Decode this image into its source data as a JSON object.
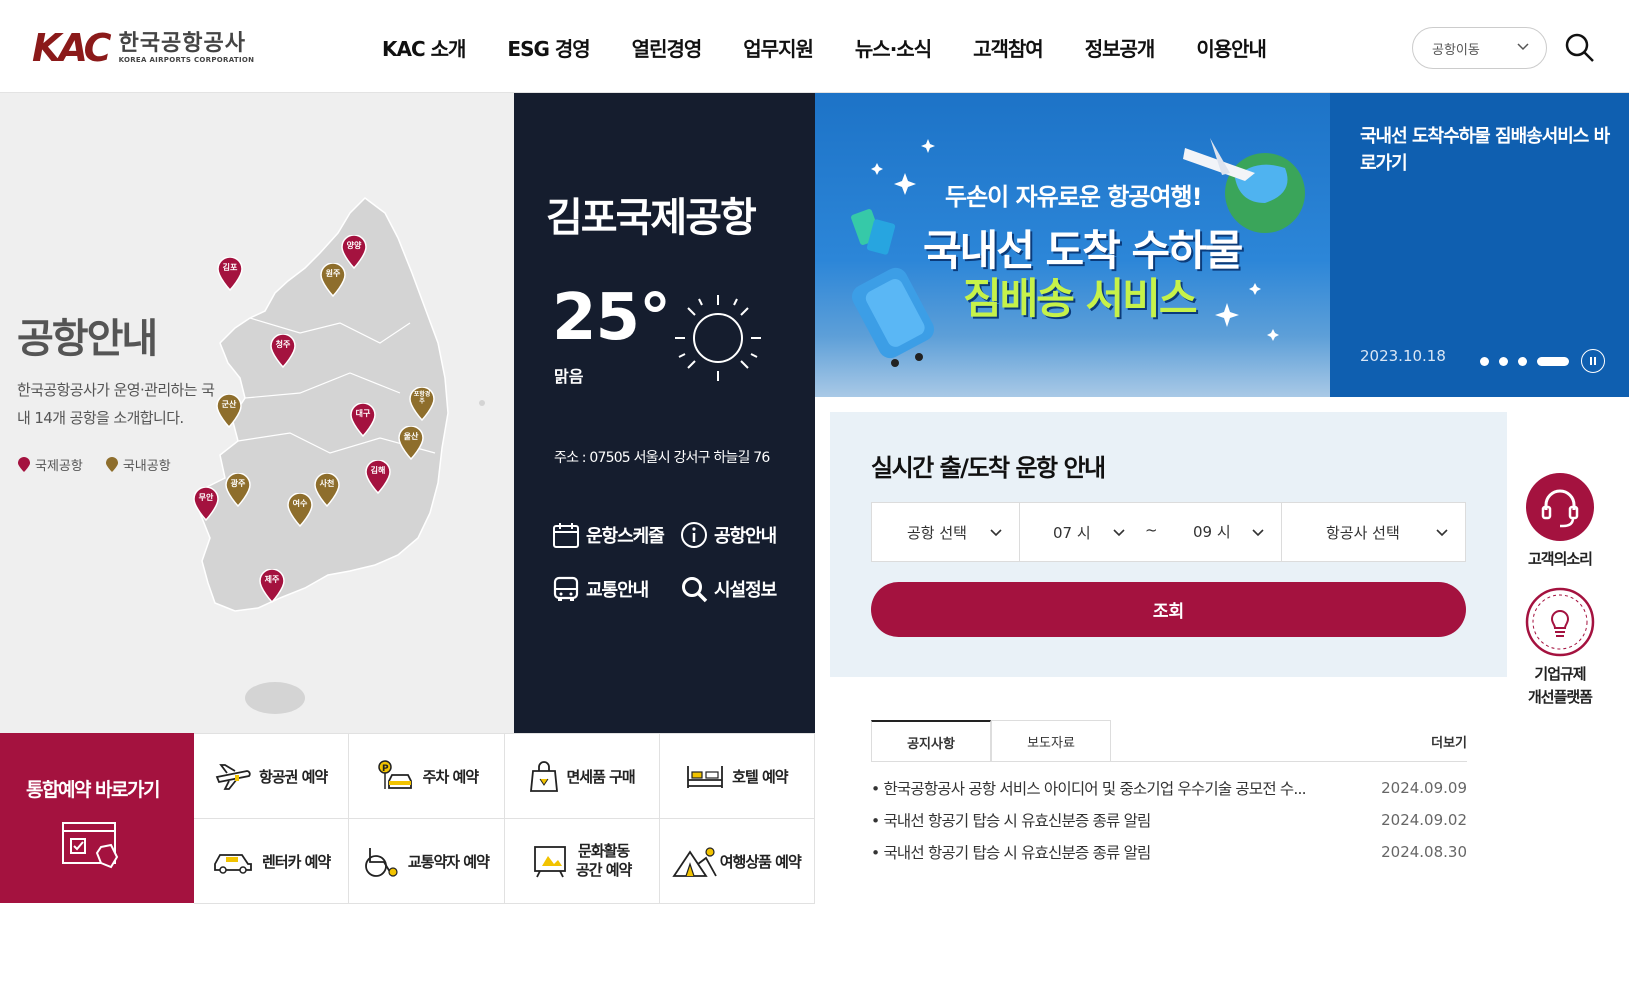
{
  "header": {
    "logo_mark": "KAC",
    "logo_ko": "한국공항공사",
    "logo_en": "KOREA AIRPORTS CORPORATION",
    "nav": [
      "KAC 소개",
      "ESG 경영",
      "열린경영",
      "업무지원",
      "뉴스·소식",
      "고객참여",
      "정보공개",
      "이용안내"
    ],
    "airport_select": "공항이동"
  },
  "map": {
    "title": "공항안내",
    "desc": "한국공항공사가 운영·관리하는 국내 14개 공항을 소개합니다.",
    "legend_intl": "국제공항",
    "legend_domestic": "국내공항",
    "airports": [
      {
        "name": "김포",
        "type": "intl"
      },
      {
        "name": "양양",
        "type": "intl"
      },
      {
        "name": "원주",
        "type": "domestic"
      },
      {
        "name": "청주",
        "type": "intl"
      },
      {
        "name": "군산",
        "type": "domestic"
      },
      {
        "name": "대구",
        "type": "intl"
      },
      {
        "name": "포항경주",
        "type": "domestic"
      },
      {
        "name": "울산",
        "type": "domestic"
      },
      {
        "name": "김해",
        "type": "intl"
      },
      {
        "name": "광주",
        "type": "domestic"
      },
      {
        "name": "무안",
        "type": "intl"
      },
      {
        "name": "사천",
        "type": "domestic"
      },
      {
        "name": "여수",
        "type": "domestic"
      },
      {
        "name": "제주",
        "type": "intl"
      }
    ],
    "intl_color": "#a4123f",
    "domestic_color": "#8e6e2c"
  },
  "weather": {
    "airport": "김포국제공항",
    "temp": "25°",
    "condition": "맑음",
    "address": "주소 : 07505 서울시 강서구 하늘길 76",
    "links": [
      "운항스케줄",
      "공항안내",
      "교통안내",
      "시설정보"
    ]
  },
  "banner": {
    "sub": "두손이 자유로운 항공여행!",
    "main1": "국내선 도착 수하물",
    "main2": "짐배송 서비스",
    "title": "국내선 도착수하물 짐배송서비스 바로가기",
    "date": "2023.10.18"
  },
  "flight": {
    "title": "실시간 출/도착 운항 안내",
    "airport": "공항 선택",
    "from_hour": "07 시",
    "tilde": "~",
    "to_hour": "09 시",
    "airline": "항공사 선택",
    "search": "조회"
  },
  "notice": {
    "tabs": [
      "공지사항",
      "보도자료"
    ],
    "more": "더보기",
    "items": [
      {
        "title": "한국공항공사 공항 서비스 아이디어 및 중소기업 우수기술 공모전 수...",
        "date": "2024.09.09"
      },
      {
        "title": "국내선 항공기 탑승 시 유효신분증 종류 알림",
        "date": "2024.09.02"
      },
      {
        "title": "국내선 항공기 탑승 시 유효신분증 종류 알림",
        "date": "2024.08.30"
      }
    ]
  },
  "quick": {
    "voice": "고객의소리",
    "regulation_1": "기업규제",
    "regulation_2": "개선플랫폼"
  },
  "reserve": {
    "main": "통합예약 바로가기",
    "items": [
      "항공권 예약",
      "주차 예약",
      "면세품 구매",
      "호텔 예약",
      "렌터카 예약",
      "교통약자 예약",
      "문화활동 공간 예약",
      "여행상품 예약"
    ],
    "culture_1": "문화활동",
    "culture_2": "공간 예약"
  },
  "colors": {
    "brand": "#a4123f",
    "dark_panel": "#151d2e",
    "banner_blue": "#0f5fb0"
  }
}
